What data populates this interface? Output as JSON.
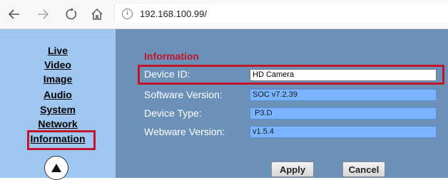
{
  "browser": {
    "url": "192.168.100.99/",
    "info_glyph": "i"
  },
  "sidebar": {
    "items": [
      {
        "label": "Live"
      },
      {
        "label": "Video"
      },
      {
        "label": "Image"
      },
      {
        "label": "Audio"
      },
      {
        "label": "System"
      },
      {
        "label": "Network"
      },
      {
        "label": "Information"
      }
    ],
    "active_item": "Information"
  },
  "main": {
    "section_title": "Information",
    "fields": [
      {
        "label": "Device ID:",
        "value": "HD Camera",
        "editable": true
      },
      {
        "label": "Software Version:",
        "value": "SOC v7.2.39",
        "editable": false
      },
      {
        "label": "Device Type:",
        "value": " P3.D",
        "editable": false
      },
      {
        "label": "Webware Version:",
        "value": "v1.5.4",
        "editable": false
      }
    ],
    "apply_label": "Apply",
    "cancel_label": "Cancel"
  },
  "colors": {
    "sidebar_bg": "#9ec6ee",
    "main_bg": "#6c91b9",
    "highlight": "#c0152b",
    "readonly_field": "#7ab4ff"
  }
}
